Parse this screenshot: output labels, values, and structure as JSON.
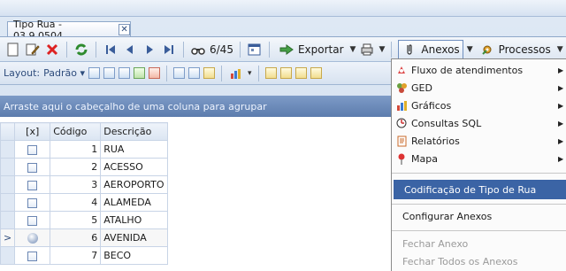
{
  "tab": {
    "title": "Tipo Rua - 03.9.0504",
    "close": "✕"
  },
  "toolbar": {
    "record_counter": "6/45",
    "export_label": "Exportar",
    "anexos_label": "Anexos",
    "processos_label": "Processos"
  },
  "layout_bar": {
    "label": "Layout:",
    "preset": "Padrão"
  },
  "group_panel": {
    "hint": "Arraste aqui o cabeçalho de uma coluna para agrupar"
  },
  "grid": {
    "headers": {
      "check": "[x]",
      "code": "Código",
      "description": "Descrição"
    },
    "rows": [
      {
        "code": "1",
        "description": "RUA"
      },
      {
        "code": "2",
        "description": "ACESSO"
      },
      {
        "code": "3",
        "description": "AEROPORTO"
      },
      {
        "code": "4",
        "description": "ALAMEDA"
      },
      {
        "code": "5",
        "description": "ATALHO"
      },
      {
        "code": "6",
        "description": "AVENIDA",
        "indicator": ">"
      },
      {
        "code": "7",
        "description": "BECO"
      }
    ]
  },
  "menu": {
    "items": [
      {
        "label": "Fluxo de atendimentos",
        "icon": "flow-icon"
      },
      {
        "label": "GED",
        "icon": "ged-icon"
      },
      {
        "label": "Gráficos",
        "icon": "chart-icon"
      },
      {
        "label": "Consultas SQL",
        "icon": "sql-query-icon"
      },
      {
        "label": "Relatórios",
        "icon": "report-icon"
      },
      {
        "label": "Mapa",
        "icon": "map-pin-icon"
      }
    ],
    "highlighted": "Codificação de Tipo de Rua",
    "configure": "Configurar Anexos",
    "close_attachment": "Fechar Anexo",
    "close_all": "Fechar Todos os Anexos"
  },
  "colors": {
    "accent": "#3b64a5",
    "group_panel": "#6d8bbb"
  }
}
